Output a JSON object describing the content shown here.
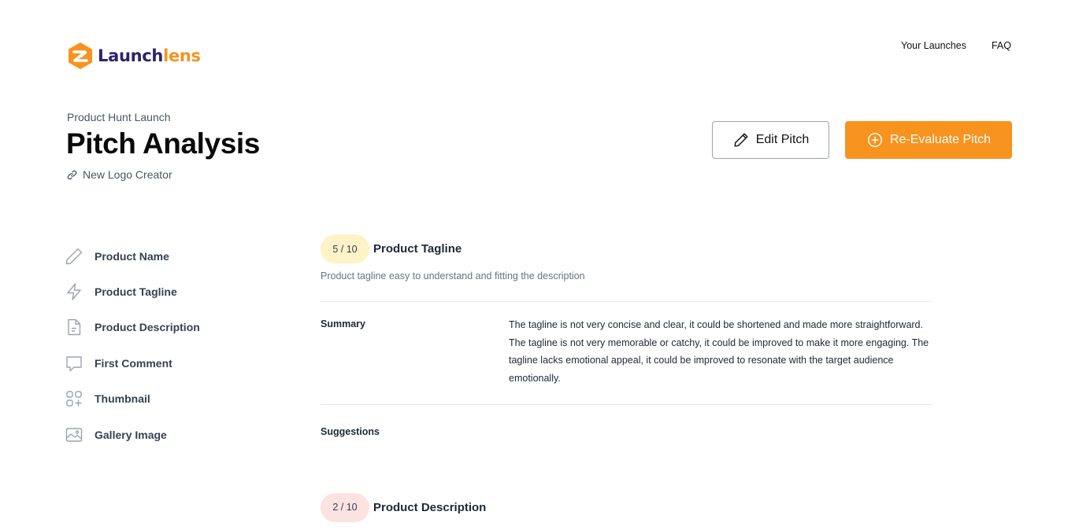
{
  "brand": {
    "name_part1": "Launch",
    "name_part2": "lens",
    "color_dark": "#2b2370",
    "color_accent": "#f7931e"
  },
  "topnav": [
    {
      "label": "Your Launches"
    },
    {
      "label": "FAQ"
    }
  ],
  "header": {
    "eyebrow": "Product Hunt Launch",
    "title": "Pitch Analysis",
    "product_link": "New Logo Creator",
    "link_icon": "link-icon"
  },
  "actions": {
    "edit_label": "Edit Pitch",
    "edit_icon": "pencil-icon",
    "reevaluate_label": "Re-Evaluate Pitch",
    "reevaluate_icon": "plus-circle-icon"
  },
  "sidebar": {
    "items": [
      {
        "label": "Product Name",
        "icon": "pencil-icon"
      },
      {
        "label": "Product Tagline",
        "icon": "lightning-icon"
      },
      {
        "label": "Product Description",
        "icon": "document-icon"
      },
      {
        "label": "First Comment",
        "icon": "chat-bubble-icon"
      },
      {
        "label": "Thumbnail",
        "icon": "grid-plus-icon"
      },
      {
        "label": "Gallery Image",
        "icon": "image-icon"
      }
    ]
  },
  "sections": [
    {
      "score": "5 / 10",
      "score_color": "#fdf3c7",
      "title": "Product Tagline",
      "description": "Product tagline easy to understand and fitting the description",
      "summary_label": "Summary",
      "summary": "The tagline is not very concise and clear, it could be shortened and made more straightforward. The tagline is not very memorable or catchy, it could be improved to make it more engaging. The tagline lacks emotional appeal, it could be improved to resonate with the target audience emotionally.",
      "suggestions_label": "Suggestions"
    },
    {
      "score": "2 / 10",
      "score_color": "#fde2e2",
      "title": "Product Description"
    }
  ]
}
